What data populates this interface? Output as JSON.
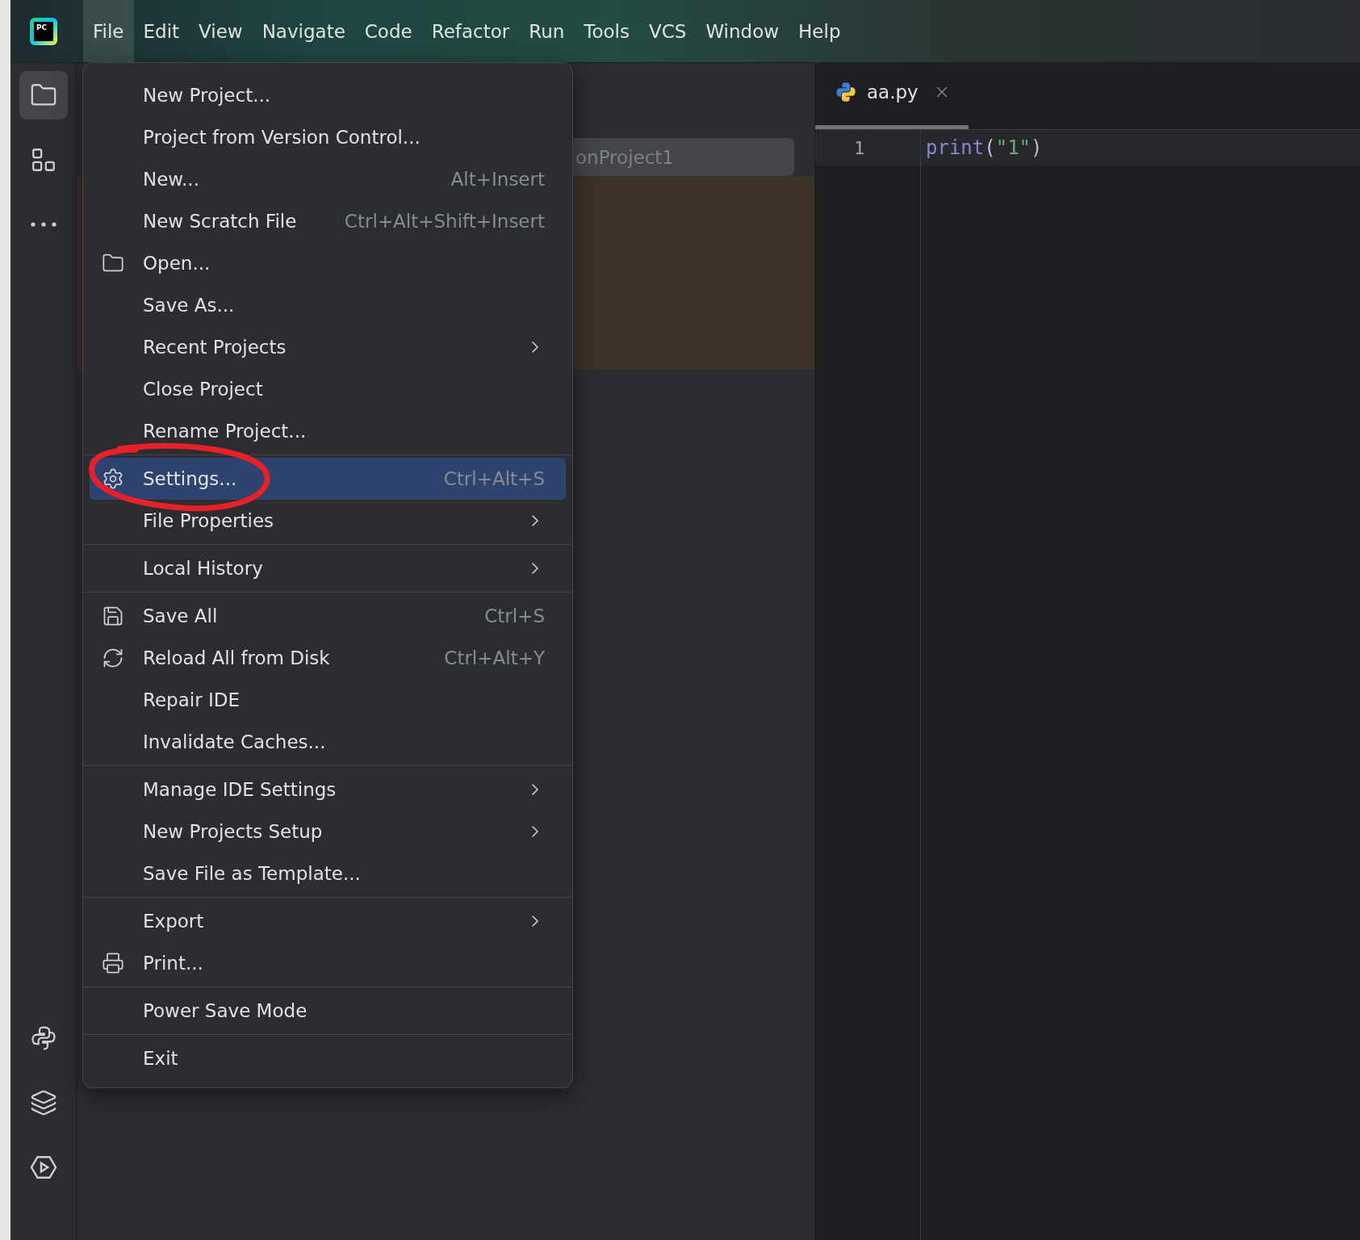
{
  "logo": {
    "text": "PC"
  },
  "menubar": [
    {
      "label": "File",
      "selected": true
    },
    {
      "label": "Edit",
      "selected": false
    },
    {
      "label": "View",
      "selected": false
    },
    {
      "label": "Navigate",
      "selected": false
    },
    {
      "label": "Code",
      "selected": false
    },
    {
      "label": "Refactor",
      "selected": false
    },
    {
      "label": "Run",
      "selected": false
    },
    {
      "label": "Tools",
      "selected": false
    },
    {
      "label": "VCS",
      "selected": false
    },
    {
      "label": "Window",
      "selected": false
    },
    {
      "label": "Help",
      "selected": false
    }
  ],
  "toolstrip": {
    "top": [
      {
        "selected": true
      },
      {
        "selected": false
      },
      {
        "selected": false
      }
    ],
    "bottom": [
      {
        "selected": false
      },
      {
        "selected": false
      },
      {
        "selected": false
      }
    ]
  },
  "project_panel": {
    "field_text": "onProject1"
  },
  "file_menu": {
    "groups": [
      [
        {
          "label": "New Project...",
          "submenu": false,
          "selected": false
        },
        {
          "label": "Project from Version Control...",
          "submenu": false,
          "selected": false
        },
        {
          "label": "New...",
          "shortcut": "Alt+Insert",
          "submenu": false,
          "selected": false
        },
        {
          "label": "New Scratch File",
          "shortcut": "Ctrl+Alt+Shift+Insert",
          "submenu": false,
          "selected": false
        },
        {
          "label": "Open...",
          "submenu": false,
          "selected": false
        },
        {
          "label": "Save As...",
          "submenu": false,
          "selected": false
        },
        {
          "label": "Recent Projects",
          "submenu": true,
          "selected": false
        },
        {
          "label": "Close Project",
          "submenu": false,
          "selected": false
        },
        {
          "label": "Rename Project...",
          "submenu": false,
          "selected": false
        }
      ],
      [
        {
          "label": "Settings...",
          "shortcut": "Ctrl+Alt+S",
          "submenu": false,
          "selected": true
        },
        {
          "label": "File Properties",
          "submenu": true,
          "selected": false
        }
      ],
      [
        {
          "label": "Local History",
          "submenu": true,
          "selected": false
        }
      ],
      [
        {
          "label": "Save All",
          "shortcut": "Ctrl+S",
          "submenu": false,
          "selected": false
        },
        {
          "label": "Reload All from Disk",
          "shortcut": "Ctrl+Alt+Y",
          "submenu": false,
          "selected": false
        },
        {
          "label": "Repair IDE",
          "submenu": false,
          "selected": false
        },
        {
          "label": "Invalidate Caches...",
          "submenu": false,
          "selected": false
        }
      ],
      [
        {
          "label": "Manage IDE Settings",
          "submenu": true,
          "selected": false
        },
        {
          "label": "New Projects Setup",
          "submenu": true,
          "selected": false
        },
        {
          "label": "Save File as Template...",
          "submenu": false,
          "selected": false
        }
      ],
      [
        {
          "label": "Export",
          "submenu": true,
          "selected": false
        },
        {
          "label": "Print...",
          "submenu": false,
          "selected": false
        }
      ],
      [
        {
          "label": "Power Save Mode",
          "submenu": false,
          "selected": false
        }
      ],
      [
        {
          "label": "Exit",
          "submenu": false,
          "selected": false
        }
      ]
    ]
  },
  "editor": {
    "tabs": [
      {
        "label": "aa.py",
        "selected": true
      }
    ],
    "lines": [
      {
        "number": "1",
        "tokens": [
          {
            "kind": "builtin",
            "text": "print"
          },
          {
            "kind": "punct",
            "text": "("
          },
          {
            "kind": "string",
            "text": "\"1\""
          },
          {
            "kind": "punct",
            "text": ")"
          }
        ]
      }
    ]
  }
}
